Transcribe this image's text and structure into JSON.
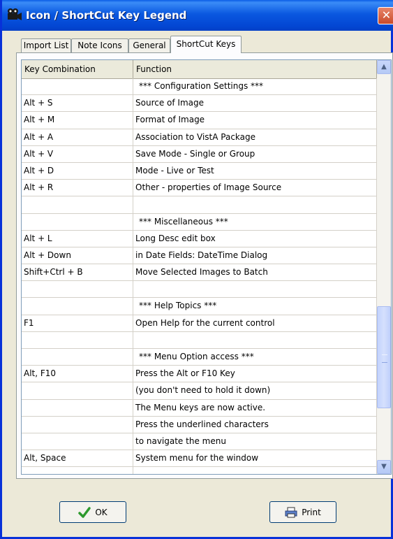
{
  "window": {
    "title": "Icon / ShortCut Key Legend",
    "close_glyph": "✕"
  },
  "tabs": [
    {
      "label": "Import List"
    },
    {
      "label": "Note Icons"
    },
    {
      "label": "General"
    },
    {
      "label": "ShortCut Keys",
      "active": true
    }
  ],
  "grid": {
    "headers": [
      "Key Combination",
      "Function"
    ],
    "rows": [
      [
        "",
        "*** Configuration Settings ***"
      ],
      [
        "Alt + S",
        "Source of Image"
      ],
      [
        "Alt + M",
        "Format of Image"
      ],
      [
        "Alt + A",
        "Association to VistA Package"
      ],
      [
        "Alt + V",
        "Save Mode - Single or Group"
      ],
      [
        "Alt + D",
        "Mode - Live or Test"
      ],
      [
        "Alt + R",
        "Other - properties of Image Source"
      ],
      [
        "",
        ""
      ],
      [
        "",
        "*** Miscellaneous ***"
      ],
      [
        "Alt + L",
        "Long Desc edit box"
      ],
      [
        "Alt + Down",
        "in Date Fields: DateTime Dialog"
      ],
      [
        "Shift+Ctrl + B",
        "Move Selected Images to Batch"
      ],
      [
        "",
        ""
      ],
      [
        "",
        "*** Help Topics ***"
      ],
      [
        "F1",
        "Open Help for the current control"
      ],
      [
        "",
        ""
      ],
      [
        "",
        "*** Menu Option access ***"
      ],
      [
        "Alt, F10",
        "Press the Alt or F10 Key"
      ],
      [
        "",
        "(you don't need to hold it down)"
      ],
      [
        "",
        " The Menu keys are now active."
      ],
      [
        "",
        " Press the underlined characters"
      ],
      [
        "",
        " to navigate the menu"
      ],
      [
        "Alt, Space",
        "System menu for the window"
      ],
      [
        "",
        ""
      ]
    ]
  },
  "scrollbar": {
    "up_glyph": "▲",
    "down_glyph": "▼"
  },
  "buttons": {
    "ok_label": "OK",
    "print_label": "Print"
  },
  "colors": {
    "titlebar": "#0a58e0",
    "dialog_bg": "#ece9d8",
    "ok_check": "#2e9a2e",
    "close": "#c94a2a"
  }
}
